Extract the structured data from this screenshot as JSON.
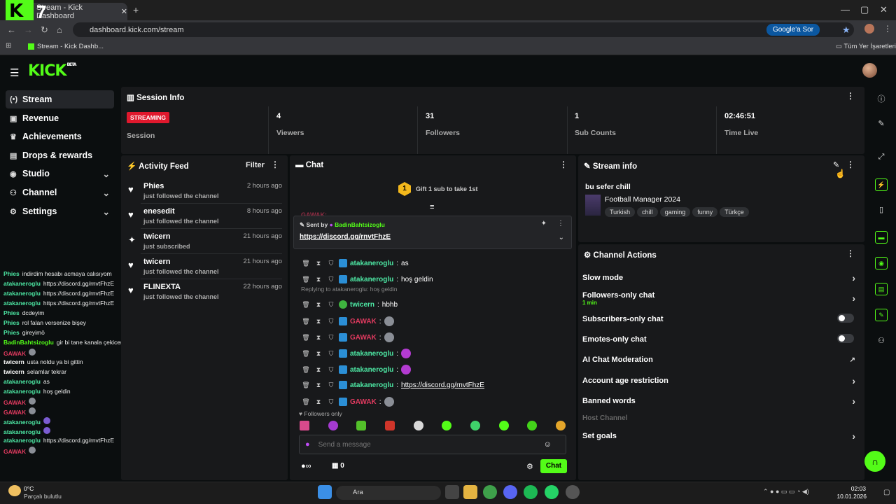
{
  "browser": {
    "tab_title": "Stream - Kick Dashboard",
    "badge_number": "7",
    "url": "dashboard.kick.com/stream",
    "google_lens": "Google'a Sor",
    "bookmark": "Stream - Kick Dashb...",
    "all_bookmarks": "Tüm Yer İşaretleri"
  },
  "brand": {
    "logo": "KICK",
    "beta": "BETA",
    "accent": "#53fc18"
  },
  "sidebar": {
    "items": [
      {
        "label": "Stream",
        "icon": "broadcast-icon"
      },
      {
        "label": "Revenue",
        "icon": "revenue-icon"
      },
      {
        "label": "Achievements",
        "icon": "trophy-icon"
      },
      {
        "label": "Drops & rewards",
        "icon": "gift-icon"
      },
      {
        "label": "Studio",
        "icon": "studio-icon"
      },
      {
        "label": "Channel",
        "icon": "channel-icon"
      },
      {
        "label": "Settings",
        "icon": "gear-icon"
      }
    ]
  },
  "session": {
    "title": "Session Info",
    "streaming_badge": "STREAMING",
    "session_label": "Session",
    "viewers": "4",
    "viewers_label": "Viewers",
    "followers": "31",
    "followers_label": "Followers",
    "subs": "1",
    "subs_label": "Sub Counts",
    "time_live": "02:46:51",
    "time_label": "Time Live"
  },
  "activity": {
    "title": "Activity Feed",
    "filter": "Filter",
    "items": [
      {
        "name": "Phies",
        "time": "2 hours ago",
        "desc": "just followed the channel",
        "icon": "heart-icon"
      },
      {
        "name": "enesedit",
        "time": "8 hours ago",
        "desc": "just followed the channel",
        "icon": "heart-icon"
      },
      {
        "name": "twicern",
        "time": "21 hours ago",
        "desc": "just subscribed",
        "icon": "star-icon"
      },
      {
        "name": "twicern",
        "time": "21 hours ago",
        "desc": "just followed the channel",
        "icon": "heart-icon"
      },
      {
        "name": "FLINEXTA",
        "time": "22 hours ago",
        "desc": "just followed the channel",
        "icon": "heart-icon"
      }
    ]
  },
  "chat": {
    "title": "Chat",
    "gift_badge": "1",
    "gift_text": "Gift 1 sub to take 1st",
    "pinned_sender_label": "Sent by",
    "pinned_sender": "BadinBahtsizoglu",
    "pinned_link": "https://discord.gg/rnvtFhzE",
    "partial_user": "GAWAK:",
    "messages": [
      {
        "user": "atakaneroglu",
        "color": "g",
        "text": "as"
      },
      {
        "user": "atakaneroglu",
        "color": "g",
        "text": "hoş geldin"
      },
      {
        "user": "twicern",
        "color": "g",
        "text": "hbhb",
        "reply": "Replying to atakaneroglu: hoş geldin"
      },
      {
        "user": "GAWAK",
        "color": "r",
        "text": ""
      },
      {
        "user": "GAWAK",
        "color": "r",
        "text": ""
      },
      {
        "user": "atakaneroglu",
        "color": "g",
        "text": ""
      },
      {
        "user": "atakaneroglu",
        "color": "g",
        "text": ""
      },
      {
        "user": "atakaneroglu",
        "color": "g",
        "text": "https://discord.gg/rnvtFhzE"
      },
      {
        "user": "GAWAK",
        "color": "r",
        "text": ""
      }
    ],
    "followers_only": "Followers only",
    "placeholder": "Send a message",
    "points": "0",
    "send": "Chat"
  },
  "stream_info": {
    "title": "Stream info",
    "stream_title": "bu sefer chill",
    "category": "Football Manager 2024",
    "tags": [
      "Turkish",
      "chill",
      "gaming",
      "funny",
      "Türkçe"
    ]
  },
  "channel_actions": {
    "title": "Channel Actions",
    "slow_mode": "Slow mode",
    "followers_only": "Followers-only chat",
    "followers_sub": "1 min",
    "subscribers_only": "Subscribers-only chat",
    "emotes_only": "Emotes-only chat",
    "ai_mod": "AI Chat Moderation",
    "account_age": "Account age restriction",
    "banned_words": "Banned words",
    "host_channel": "Host Channel",
    "set_goals": "Set goals"
  },
  "overlay_chat": [
    {
      "user": "Phies",
      "c": "g",
      "text": "indirdim hesabı acmaya calısıyom"
    },
    {
      "user": "atakaneroglu",
      "c": "g",
      "text": "https://discord.gg/rnvtFhzE"
    },
    {
      "user": "atakaneroglu",
      "c": "g",
      "text": "https://discord.gg/rnvtFhzE"
    },
    {
      "user": "atakaneroglu",
      "c": "g",
      "text": "https://discord.gg/rnvtFhzE"
    },
    {
      "user": "Phies",
      "c": "g",
      "text": "dcdeyim"
    },
    {
      "user": "Phies",
      "c": "g",
      "text": "rol falan versenize bişey"
    },
    {
      "user": "Phies",
      "c": "g",
      "text": "gireyimö"
    },
    {
      "user": "BadinBahtsizoglu",
      "c": "gy",
      "text": "gir bi tane kanala çekicem"
    },
    {
      "user": "GAWAK",
      "c": "r",
      "text": ""
    },
    {
      "user": "twicern",
      "c": "w",
      "text": "usta noldu ya bi gittin"
    },
    {
      "user": "twicern",
      "c": "w",
      "text": "selamlar tekrar"
    },
    {
      "user": "atakaneroglu",
      "c": "g",
      "text": "as"
    },
    {
      "user": "atakaneroglu",
      "c": "g",
      "text": "hoş geldin"
    },
    {
      "user": "GAWAK",
      "c": "r",
      "text": ""
    },
    {
      "user": "GAWAK",
      "c": "r",
      "text": ""
    },
    {
      "user": "atakaneroglu",
      "c": "g",
      "text": ""
    },
    {
      "user": "atakaneroglu",
      "c": "g",
      "text": ""
    },
    {
      "user": "atakaneroglu",
      "c": "g",
      "text": "https://discord.gg/rnvtFhzE"
    },
    {
      "user": "GAWAK",
      "c": "r",
      "text": ""
    }
  ],
  "taskbar": {
    "temp": "0°C",
    "weather": "Parçalı bulutlu",
    "search": "Ara",
    "time": "02:03",
    "date": "10.01.2026"
  }
}
